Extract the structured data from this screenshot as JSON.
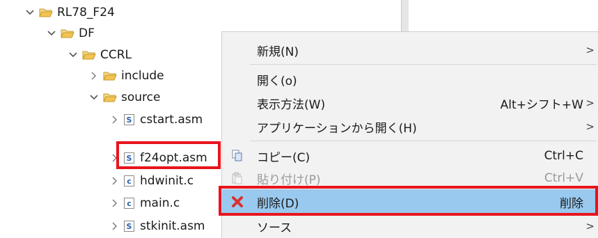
{
  "tree": {
    "items": [
      {
        "label": "RL78_F24",
        "kind": "folder",
        "expanded": true
      },
      {
        "label": "DF",
        "kind": "folder",
        "expanded": true
      },
      {
        "label": "CCRL",
        "kind": "folder",
        "expanded": true
      },
      {
        "label": "include",
        "kind": "folder",
        "expanded": false
      },
      {
        "label": "source",
        "kind": "folder",
        "expanded": true
      },
      {
        "label": "cstart.asm",
        "kind": "asm-file",
        "badge": "S"
      },
      {
        "label": "f24opt.asm",
        "kind": "asm-file",
        "badge": "S"
      },
      {
        "label": "hdwinit.c",
        "kind": "c-file",
        "badge": "c"
      },
      {
        "label": "main.c",
        "kind": "c-file",
        "badge": "c"
      },
      {
        "label": "stkinit.asm",
        "kind": "asm-file",
        "badge": "S"
      }
    ]
  },
  "context_menu": {
    "items": [
      {
        "label": "新規(N)",
        "accel": "",
        "submenu": true,
        "enabled": true
      },
      {
        "label": "開く(o)",
        "accel": "",
        "submenu": false,
        "enabled": true
      },
      {
        "label": "表示方法(W)",
        "accel": "Alt+シフト+W",
        "submenu": true,
        "enabled": true
      },
      {
        "label": "アプリケーションから開く(H)",
        "accel": "",
        "submenu": true,
        "enabled": true
      },
      {
        "label": "コピー(C)",
        "accel": "Ctrl+C",
        "submenu": false,
        "enabled": true,
        "icon": "copy-icon"
      },
      {
        "label": "貼り付け(P)",
        "accel": "Ctrl+V",
        "submenu": false,
        "enabled": false,
        "icon": "paste-icon"
      },
      {
        "label": "削除(D)",
        "accel": "削除",
        "submenu": false,
        "enabled": true,
        "selected": true,
        "icon": "delete-x-icon"
      },
      {
        "label": "ソース",
        "accel": "",
        "submenu": true,
        "enabled": true
      }
    ]
  },
  "colors": {
    "highlight_border": "#e8141c",
    "selection": "#99c9ef",
    "delete_icon": "#d9302c",
    "folder": "#e8b84a"
  }
}
